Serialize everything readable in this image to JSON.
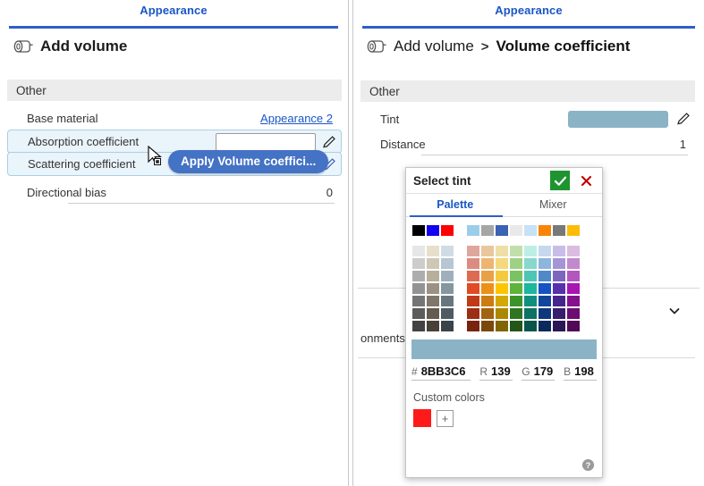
{
  "left_panel": {
    "tab_label": "Appearance",
    "header": {
      "icon": "volume-icon",
      "title": "Add volume"
    },
    "section_label": "Other",
    "rows": [
      {
        "label": "Base material",
        "value": "Appearance 2",
        "type": "link"
      },
      {
        "label": "Absorption coefficient",
        "value": "",
        "type": "input-pencil",
        "highlighted": true
      },
      {
        "label": "Scattering coefficient",
        "value": "",
        "type": "input-pencil",
        "highlighted": true
      },
      {
        "label": "Directional bias",
        "value": "0",
        "type": "text"
      }
    ],
    "tooltip": {
      "text": "Apply Volume coeffici...",
      "color": "#4472c4"
    }
  },
  "right_panel": {
    "tab_label": "Appearance",
    "breadcrumb": {
      "icon": "volume-icon",
      "root": "Add volume",
      "separator": ">",
      "current": "Volume coefficient"
    },
    "section_label": "Other",
    "rows": [
      {
        "label": "Tint",
        "value": "",
        "type": "swatch-pencil",
        "swatch": "#8BB3C6"
      },
      {
        "label": "Distance",
        "value": "1",
        "type": "text"
      }
    ],
    "behind_text": "onments",
    "collapse_icon": "chevron-down-icon"
  },
  "tint_dialog": {
    "title": "Select tint",
    "confirm_icon": "check-icon",
    "confirm_color": "#1e9430",
    "cancel_icon": "close-icon",
    "cancel_color": "#c00000",
    "tabs": [
      {
        "label": "Palette",
        "active": true
      },
      {
        "label": "Mixer",
        "active": false
      }
    ],
    "top_row_left": [
      "#000000",
      "#1400F0",
      "#FF0000"
    ],
    "top_row_right": [
      "#9CCEEA",
      "#A6A6A6",
      "#3A62B5",
      "#E9E9E9",
      "#C6E2F5",
      "#F98407",
      "#787878",
      "#FDBC08"
    ],
    "grid_left": [
      [
        "#E6E6E6",
        "#E6DFCB",
        "#CFDCE5"
      ],
      [
        "#CCCCCC",
        "#CEC7B4",
        "#B6C6D2"
      ],
      [
        "#ADADAD",
        "#B7AE9C",
        "#9EB0BE"
      ],
      [
        "#939393",
        "#9B9283",
        "#85979F"
      ],
      [
        "#757575",
        "#7F776A",
        "#68777F"
      ],
      [
        "#5C5C5C",
        "#625B50",
        "#4F5B62"
      ],
      [
        "#434343",
        "#474138",
        "#3A4349"
      ]
    ],
    "grid_right": [
      [
        "#DFA79C",
        "#E9C79D",
        "#EEDFA6",
        "#C0DFAC",
        "#BDEEE6",
        "#C6D8EE",
        "#C9BCE8",
        "#D9BCE0"
      ],
      [
        "#DC8C7E",
        "#EDB571",
        "#F3D87E",
        "#9FD184",
        "#86D9CC",
        "#8DB5DE",
        "#A695D6",
        "#C289CE"
      ],
      [
        "#DD6A53",
        "#E8A144",
        "#F5C93E",
        "#7BC263",
        "#4FC6B4",
        "#5089C8",
        "#7D67BD",
        "#B357BF"
      ],
      [
        "#E04A25",
        "#ED9018",
        "#FDC500",
        "#5EB33B",
        "#1DB69E",
        "#1652C4",
        "#5730AE",
        "#A715B5"
      ],
      [
        "#C03A18",
        "#CC7C11",
        "#D4A802",
        "#3C9329",
        "#118F7E",
        "#12459C",
        "#46268B",
        "#86118F"
      ],
      [
        "#9C2E13",
        "#A4630E",
        "#AB8702",
        "#2F7520",
        "#0D7265",
        "#0E377C",
        "#381E6F",
        "#6B0E72"
      ],
      [
        "#78230E",
        "#7A490A",
        "#806502",
        "#225718",
        "#0A554B",
        "#0A295C",
        "#2A1754",
        "#500A56"
      ]
    ],
    "preview_color": "#8BB3C6",
    "values": {
      "hex_key": "#",
      "hex": "8BB3C6",
      "r_key": "R",
      "r": "139",
      "g_key": "G",
      "g": "179",
      "b_key": "B",
      "b": "198"
    },
    "custom_colors_label": "Custom colors",
    "custom_swatches": [
      "#FF1A1A"
    ],
    "add_custom_label": "+",
    "help_icon": "help-icon"
  }
}
